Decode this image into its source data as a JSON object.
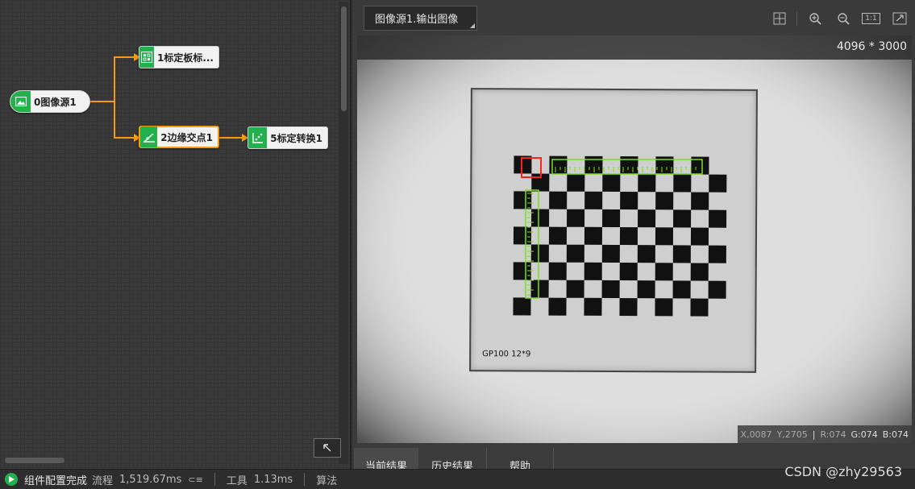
{
  "flow": {
    "nodes": [
      {
        "label": "0图像源1",
        "icon": "image-icon"
      },
      {
        "label": "1标定板标...",
        "icon": "calibration-board-icon"
      },
      {
        "label": "2边缘交点1",
        "icon": "edge-intersection-icon"
      },
      {
        "label": "5标定转换1",
        "icon": "calibration-transform-icon"
      }
    ],
    "colors": {
      "node_icon": "#23b14d",
      "connector": "#f39c12",
      "selected_border": "#f39c12"
    }
  },
  "viewer": {
    "tab_label": "图像源1.输出图像",
    "resolution": "4096 * 3000",
    "paper_label": "GP100 12*9",
    "pixel_info": {
      "x": "X,0087",
      "y": "Y,2705",
      "r": "R:074",
      "g": "G:074",
      "b": "B:074"
    },
    "toolbar_icons": [
      "crosshair-icon",
      "zoom-in-icon",
      "zoom-out-icon",
      "actual-size-icon",
      "fit-window-icon"
    ],
    "toolbar": {
      "actual_size_label": "1:1"
    }
  },
  "result_tabs": [
    {
      "label": "当前结果",
      "active": true
    },
    {
      "label": "历史结果",
      "active": false
    },
    {
      "label": "帮助",
      "active": false
    }
  ],
  "status_bar": {
    "status": "组件配置完成",
    "flow_label": "流程",
    "flow_time": "1,519.67ms",
    "tool_label": "工具",
    "tool_time": "1.13ms",
    "algo_label": "算法"
  },
  "watermark": "CSDN @zhy29563"
}
